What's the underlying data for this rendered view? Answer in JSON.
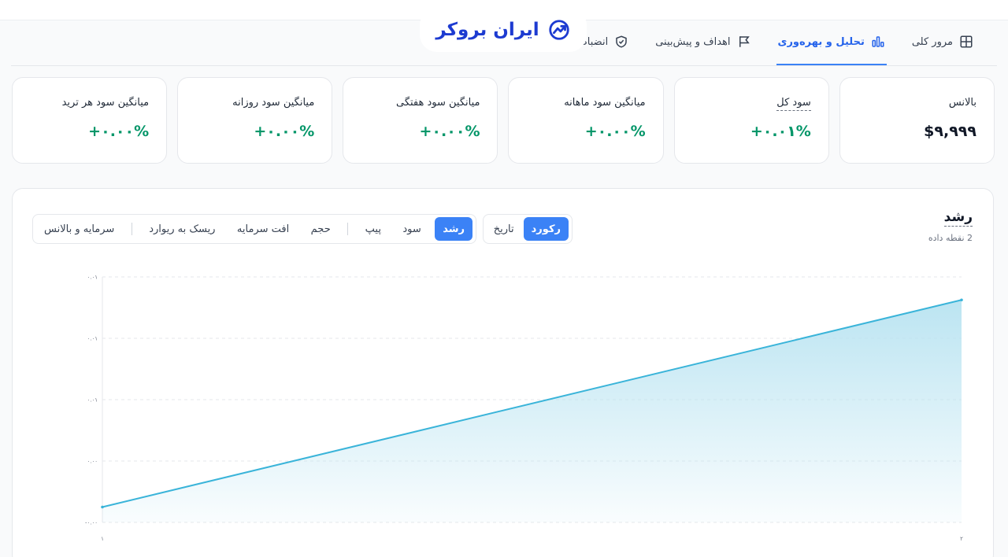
{
  "logo": {
    "text": "ایران بروکر",
    "icon": "trend-up-icon"
  },
  "tabs": [
    {
      "label": "مرور کلی",
      "icon": "grid-icon",
      "active": false
    },
    {
      "label": "تحلیل و بهره‌وری",
      "icon": "bar-chart-icon",
      "active": true
    },
    {
      "label": "اهداف و پیش‌بینی",
      "icon": "flag-icon",
      "active": false
    },
    {
      "label": "انضباط",
      "icon": "shield-icon",
      "active": false
    }
  ],
  "cards": [
    {
      "label": "بالانس",
      "value": "$۹,۹۹۹",
      "dashed": false,
      "color": "#111827"
    },
    {
      "label": "سود کل",
      "value": "+۰.۰۱%",
      "dashed": true,
      "color": "#059669"
    },
    {
      "label": "میانگین سود ماهانه",
      "value": "+۰.۰۰%",
      "dashed": false,
      "color": "#059669"
    },
    {
      "label": "میانگین سود هفتگی",
      "value": "+۰.۰۰%",
      "dashed": false,
      "color": "#059669"
    },
    {
      "label": "میانگین سود روزانه",
      "value": "+۰.۰۰%",
      "dashed": false,
      "color": "#059669"
    },
    {
      "label": "میانگین سود هر ترید",
      "value": "+۰.۰۰%",
      "dashed": false,
      "color": "#059669"
    }
  ],
  "chart_panel": {
    "title": "رشد",
    "subtitle": "2 نقطه داده",
    "mode_toggle": [
      {
        "label": "رکورد",
        "active": true
      },
      {
        "label": "تاریخ",
        "active": false
      }
    ],
    "metric_tabs": [
      {
        "label": "رشد",
        "active": true
      },
      {
        "label": "سود",
        "active": false
      },
      {
        "label": "پیپ",
        "active": false
      },
      {
        "label": "حجم",
        "active": false,
        "sep_before": true
      },
      {
        "label": "افت سرمایه",
        "active": false
      },
      {
        "label": "ریسک به ریوارد",
        "active": false
      },
      {
        "label": "سرمایه و بالانس",
        "active": false,
        "sep_before": true
      }
    ]
  },
  "chart_data": {
    "type": "area",
    "x": [
      1,
      2
    ],
    "x_tick_labels": [
      "۱",
      "۲"
    ],
    "values": [
      -0.003,
      0.0105
    ],
    "ylim": [
      -0.004,
      0.012
    ],
    "y_tick_labels": [
      "۰.۰۱",
      "۰.۰۱",
      "۰.۰۱",
      "۰.۰۰",
      "-۰.۰۰"
    ],
    "grid": true,
    "line_color": "#3ab4d9",
    "fill_color": "#b8e3f1"
  }
}
